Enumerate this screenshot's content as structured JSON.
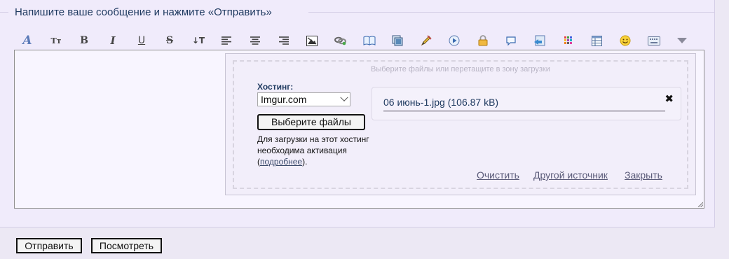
{
  "form": {
    "legend": "Напишите ваше сообщение и нажмите «Отправить»",
    "submit_label": "Отправить",
    "preview_label": "Посмотреть"
  },
  "toolbar": {
    "icons": [
      "font-face-icon",
      "font-size-icon",
      "bold-icon",
      "italic-icon",
      "underline-icon",
      "strikethrough-icon",
      "line-spacing-icon",
      "align-left-icon",
      "align-center-icon",
      "align-right-icon",
      "image-icon",
      "link-icon",
      "book-icon",
      "gallery-icon",
      "pencil-icon",
      "video-icon",
      "lock-icon",
      "speech-bubble-icon",
      "quote-icon",
      "color-palette-icon",
      "table-icon",
      "smiley-icon",
      "keyboard-icon",
      "more-dropdown-icon"
    ],
    "labels": {
      "font_size": "Tт",
      "bold": "B",
      "italic": "I",
      "underline": "U",
      "strike": "S",
      "line_spacing": "↓T"
    }
  },
  "uploader": {
    "drop_hint": "Выберите файлы или перетащите в зону загрузки",
    "host_label": "Хостинг:",
    "host_value": "Imgur.com",
    "choose_button": "Выберите файлы",
    "note_text": "Для загрузки на этот хостинг необходима активация",
    "note_link": "подробнее",
    "note_open": " (",
    "note_close": ").",
    "file": {
      "name": "06 июнь-1.jpg (106.87 kB)",
      "close": "✖",
      "progress": 1.0
    },
    "links": {
      "clear": "Очистить",
      "other_source": "Другой источник",
      "close": "Закрыть"
    }
  }
}
